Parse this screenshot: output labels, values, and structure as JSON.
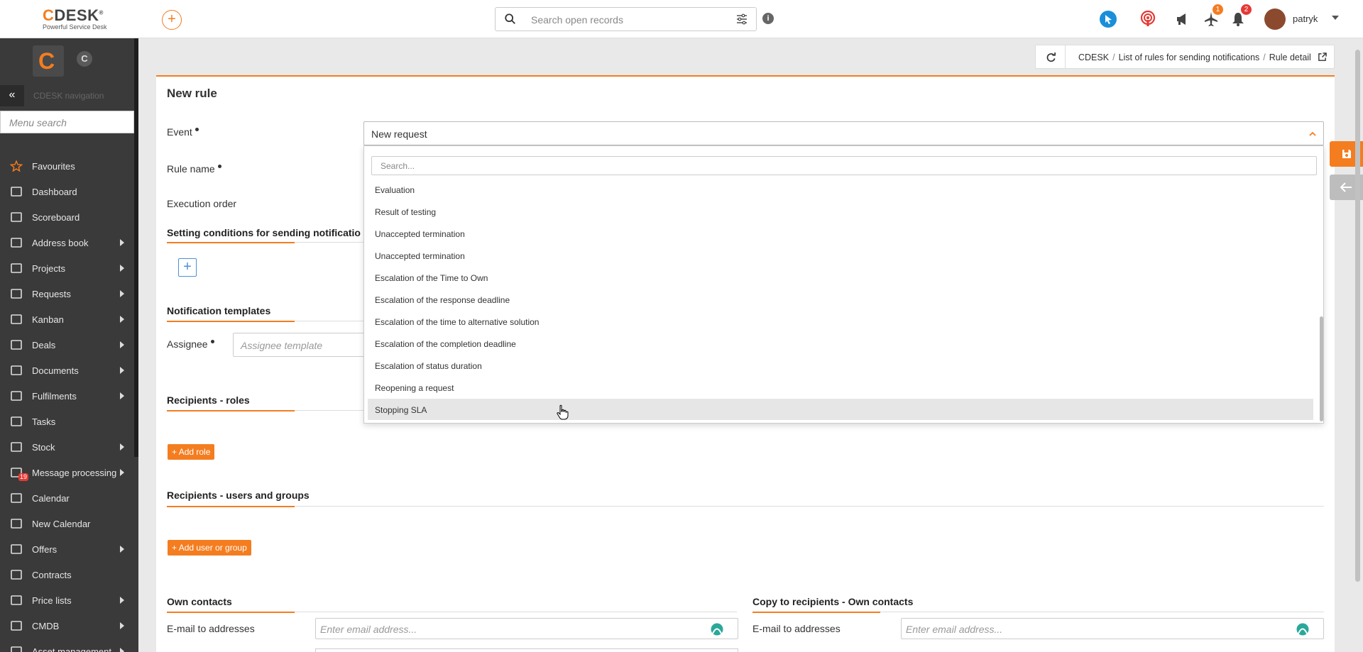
{
  "app": {
    "brand": "CDESK",
    "tagline": "Powerful Service Desk"
  },
  "header": {
    "search_placeholder": "Search open records",
    "user_name": "patryk",
    "plane_badge": "1",
    "bell_badge": "2",
    "colors": {
      "accent": "#f47d20",
      "badge": "#e53935",
      "cursor_icon": "#1a8fd9"
    }
  },
  "sidebar": {
    "nav_title": "CDESK navigation",
    "menu_search_placeholder": "Menu search",
    "items": [
      {
        "label": "Favourites",
        "icon": "star-icon",
        "has_children": false
      },
      {
        "label": "Dashboard",
        "icon": "dashboard-icon",
        "has_children": false
      },
      {
        "label": "Scoreboard",
        "icon": "chart-line-icon",
        "has_children": false
      },
      {
        "label": "Address book",
        "icon": "user-icon",
        "has_children": true
      },
      {
        "label": "Projects",
        "icon": "folder-icon",
        "has_children": true
      },
      {
        "label": "Requests",
        "icon": "target-icon",
        "has_children": true
      },
      {
        "label": "Kanban",
        "icon": "kanban-icon",
        "has_children": true
      },
      {
        "label": "Deals",
        "icon": "card-icon",
        "has_children": true
      },
      {
        "label": "Documents",
        "icon": "books-icon",
        "has_children": true
      },
      {
        "label": "Fulfilments",
        "icon": "list-icon",
        "has_children": true
      },
      {
        "label": "Tasks",
        "icon": "tasks-icon",
        "has_children": false
      },
      {
        "label": "Stock",
        "icon": "box-icon",
        "has_children": true
      },
      {
        "label": "Message processing",
        "icon": "mail-icon",
        "has_children": true,
        "badge": "19"
      },
      {
        "label": "Calendar",
        "icon": "calendar-icon",
        "has_children": false
      },
      {
        "label": "New Calendar",
        "icon": "calendar-icon",
        "has_children": false
      },
      {
        "label": "Offers",
        "icon": "gift-icon",
        "has_children": true
      },
      {
        "label": "Contracts",
        "icon": "contract-icon",
        "has_children": false
      },
      {
        "label": "Price lists",
        "icon": "pricelist-icon",
        "has_children": true
      },
      {
        "label": "CMDB",
        "icon": "folder-open-icon",
        "has_children": true
      },
      {
        "label": "Asset management",
        "icon": "asset-icon",
        "has_children": true
      }
    ]
  },
  "breadcrumb": {
    "items": [
      "CDESK",
      "List of rules for sending notifications",
      "Rule detail"
    ]
  },
  "form": {
    "title": "New rule",
    "event_label": "Event",
    "event_value": "New request",
    "rule_name_label": "Rule name",
    "execution_order_label": "Execution order",
    "conditions_heading": "Setting conditions for sending notificatio",
    "templates_heading": "Notification templates",
    "assignee_label": "Assignee",
    "assignee_placeholder": "Assignee template",
    "roles_heading": "Recipients - roles",
    "add_role_label": "Add role",
    "users_heading": "Recipients - users and groups",
    "add_user_label": "Add user or group",
    "own_contacts_heading": "Own contacts",
    "copy_heading": "Copy to recipients - Own contacts",
    "email_label": "E-mail to addresses",
    "email_placeholder": "Enter email address..."
  },
  "dropdown": {
    "search_placeholder": "Search...",
    "options": [
      "Evaluation",
      "Result of testing",
      "Unaccepted termination",
      "Unaccepted termination",
      "Escalation of the Time to Own",
      "Escalation of the response deadline",
      "Escalation of the time to alternative solution",
      "Escalation of the completion deadline",
      "Escalation of status duration",
      "Reopening a request",
      "Stopping SLA"
    ],
    "highlighted": "Stopping SLA"
  }
}
